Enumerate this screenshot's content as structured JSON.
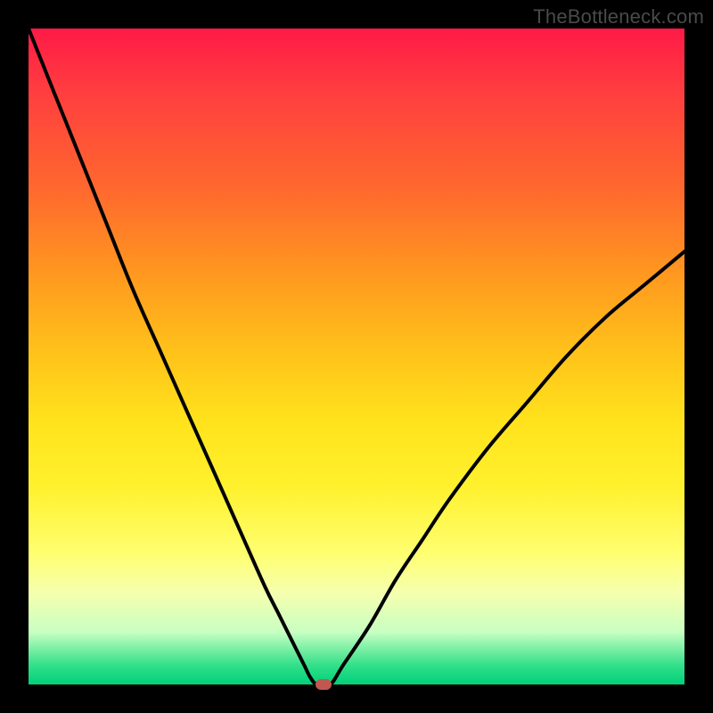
{
  "watermark": "TheBottleneck.com",
  "colors": {
    "page_bg": "#000000",
    "curve": "#000000",
    "marker": "#c1584f"
  },
  "chart_data": {
    "type": "line",
    "title": "",
    "xlabel": "",
    "ylabel": "",
    "xlim": [
      0,
      100
    ],
    "ylim": [
      0,
      100
    ],
    "grid": false,
    "legend": false,
    "series": [
      {
        "name": "bottleneck-curve",
        "x": [
          0,
          4,
          8,
          12,
          16,
          20,
          24,
          28,
          32,
          36,
          38,
          40,
          42,
          43,
          44,
          46,
          48,
          52,
          56,
          60,
          64,
          70,
          76,
          82,
          88,
          94,
          100
        ],
        "y": [
          100,
          90,
          80,
          70,
          60,
          51,
          42,
          33,
          24,
          15,
          11,
          7,
          3,
          1,
          0,
          0,
          3,
          9,
          16,
          22,
          28,
          36,
          43,
          50,
          56,
          61,
          66
        ]
      }
    ],
    "marker": {
      "x": 45,
      "y": 0
    },
    "gradient_stops": [
      {
        "pos": 0.0,
        "color": "#ff1a47"
      },
      {
        "pos": 0.1,
        "color": "#ff3f3f"
      },
      {
        "pos": 0.25,
        "color": "#ff6a2d"
      },
      {
        "pos": 0.38,
        "color": "#ff9a1f"
      },
      {
        "pos": 0.5,
        "color": "#ffc41a"
      },
      {
        "pos": 0.6,
        "color": "#ffe31c"
      },
      {
        "pos": 0.7,
        "color": "#fff12e"
      },
      {
        "pos": 0.8,
        "color": "#ffff70"
      },
      {
        "pos": 0.86,
        "color": "#f6ffae"
      },
      {
        "pos": 0.92,
        "color": "#c8ffc2"
      },
      {
        "pos": 0.97,
        "color": "#34e08a"
      },
      {
        "pos": 1.0,
        "color": "#00d07a"
      }
    ]
  }
}
